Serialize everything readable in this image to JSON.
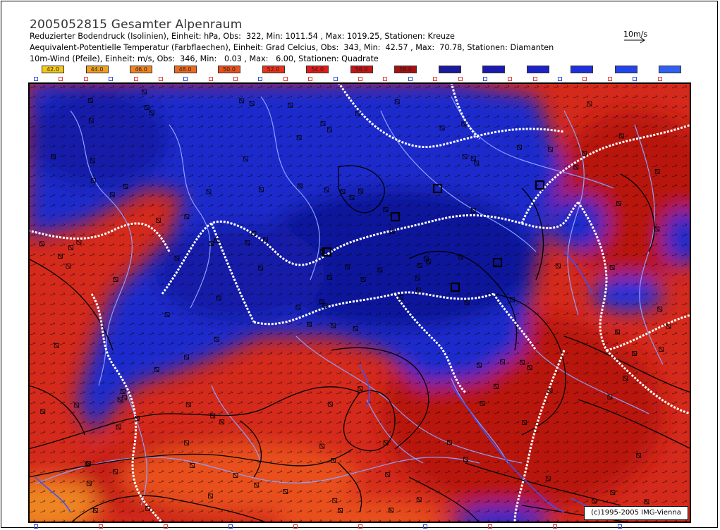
{
  "header": {
    "title": "2005052815 Gesamter Alpenraum",
    "line1": "Reduzierter Bodendruck (Isolinien), Einheit: hPa, Obs:  322, Min: 1011.54 , Max: 1019.25, Stationen: Kreuze",
    "line2": "Aequivalent-Potentielle Temperatur (Farbflaechen), Einheit: Grad Celcius, Obs:  343, Min:  42.57 , Max:  70.78, Stationen: Diamanten",
    "line3": "10m-Wind (Pfeile), Einheit: m/s, Obs:  346, Min:   0.03 , Max:   6.00, Stationen: Quadrate"
  },
  "wind_reference": {
    "label": "10m/s"
  },
  "legend": {
    "items": [
      {
        "label": "42.0",
        "color": "#f2c81a"
      },
      {
        "label": "44.0",
        "color": "#f0a020"
      },
      {
        "label": "46.0",
        "color": "#ee8422"
      },
      {
        "label": "48.0",
        "color": "#ec6a20"
      },
      {
        "label": "50.0",
        "color": "#ea501e"
      },
      {
        "label": "52.0",
        "color": "#e8321c"
      },
      {
        "label": "54.0",
        "color": "#e01a18"
      },
      {
        "label": "56.0",
        "color": "#c41414"
      },
      {
        "label": "58.0",
        "color": "#a81010"
      },
      {
        "label": "",
        "color": "#1a1a9a"
      },
      {
        "label": "",
        "color": "#1a1ab0"
      },
      {
        "label": "",
        "color": "#1c22c8"
      },
      {
        "label": "",
        "color": "#1e30dc"
      },
      {
        "label": "",
        "color": "#2244e8"
      },
      {
        "label": "",
        "color": "#3060f0"
      }
    ]
  },
  "map": {
    "colors": {
      "warm": "#d42a1c",
      "deepwarm": "#b8160e",
      "orange": "#e86a20",
      "blue": "#1a2acc",
      "darkblue": "#10189a",
      "rivers": "#8aa0ff",
      "borders": "#ffffff",
      "isobars": "#000000"
    }
  },
  "copyright": "(c)1995-2005 IMG-Vienna"
}
